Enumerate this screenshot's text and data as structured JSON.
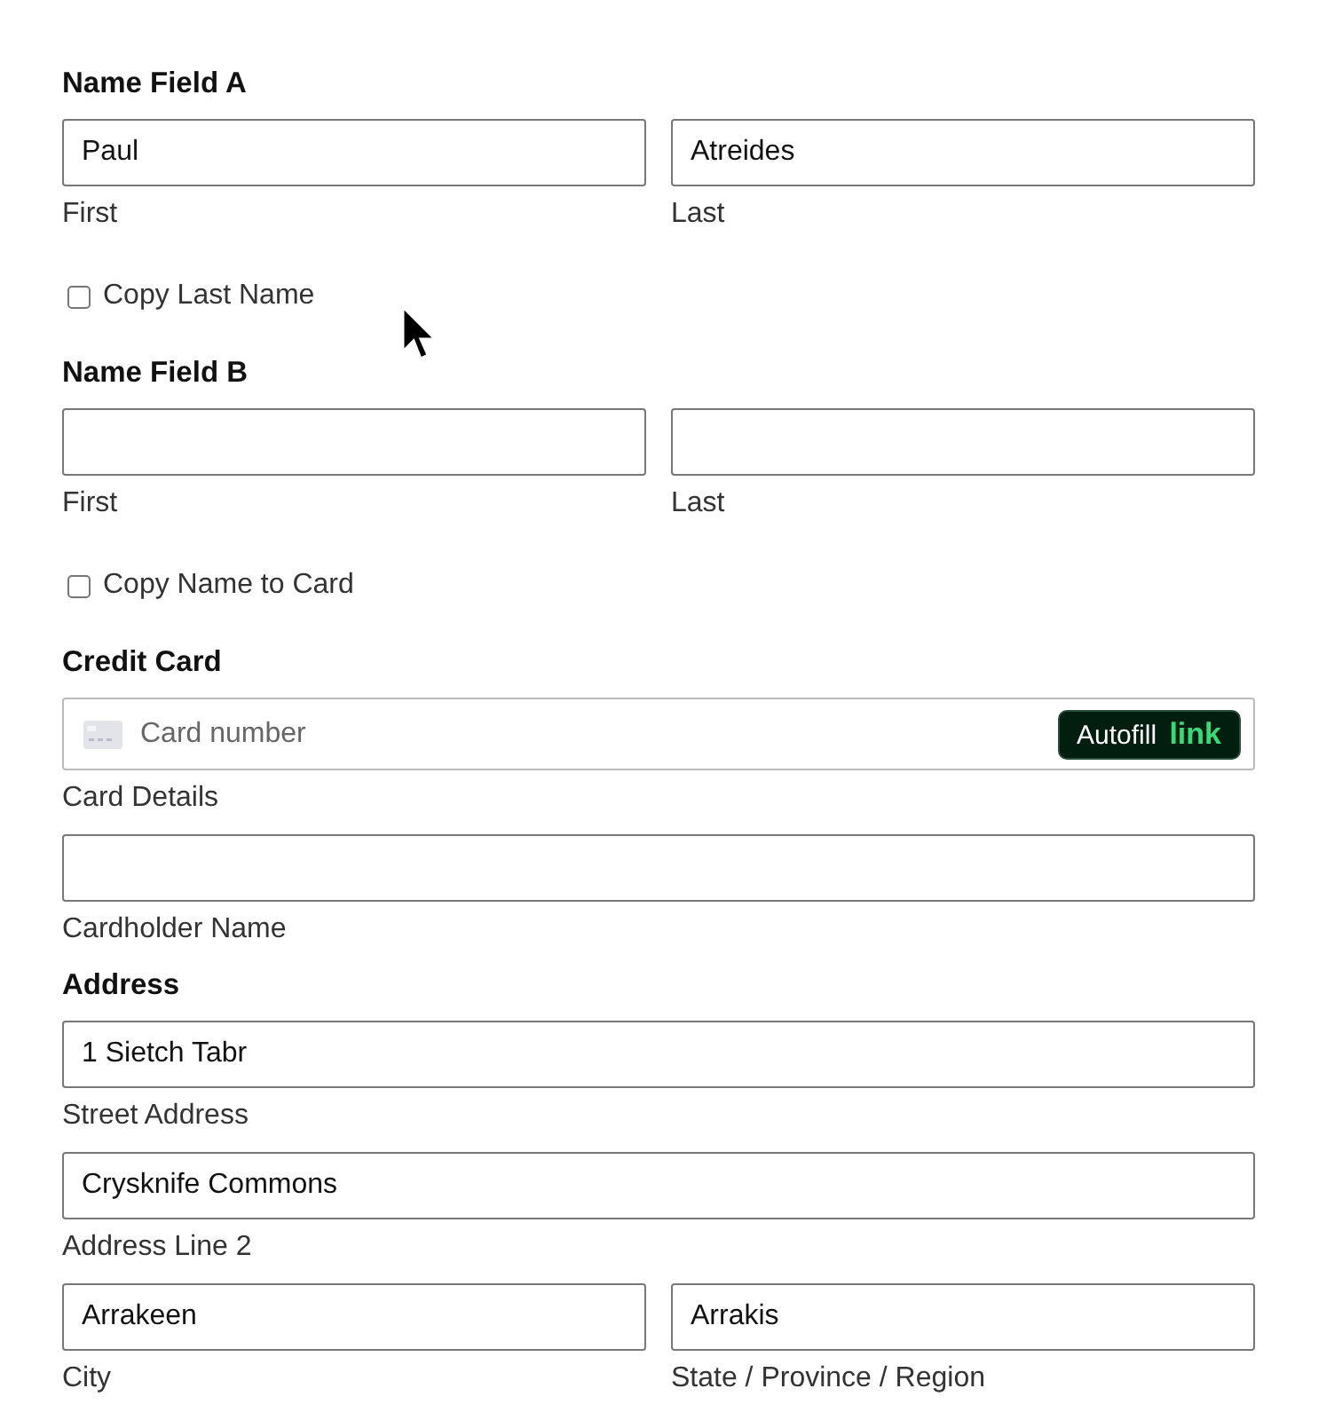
{
  "blocks": [
    {
      "kind": "heading",
      "text": "Name Field A"
    },
    {
      "kind": "fields",
      "fields": [
        {
          "value": "Paul",
          "label": "First"
        },
        {
          "value": "Atreides",
          "label": "Last"
        }
      ]
    },
    {
      "kind": "checkbox",
      "label": "Copy Last Name",
      "checked": false
    },
    {
      "kind": "heading",
      "text": "Name Field B"
    },
    {
      "kind": "fields",
      "fields": [
        {
          "label": "First"
        },
        {
          "label": "Last"
        }
      ]
    },
    {
      "kind": "checkbox",
      "label": "Copy Name to Card",
      "checked": false
    },
    {
      "kind": "heading",
      "text": "Credit Card"
    },
    {
      "kind": "card",
      "placeholder": "Card number",
      "button": "Autofill",
      "brand": "link",
      "label": "Card Details"
    },
    {
      "kind": "fields",
      "fields": [
        {
          "label": "Cardholder Name"
        }
      ]
    },
    {
      "kind": "heading",
      "text": "Address"
    },
    {
      "kind": "fields",
      "fields": [
        {
          "value": "1 Sietch Tabr",
          "label": "Street Address"
        }
      ]
    },
    {
      "kind": "fields",
      "fields": [
        {
          "value": "Crysknife Commons",
          "label": "Address Line 2"
        }
      ]
    },
    {
      "kind": "fields",
      "fields": [
        {
          "value": "Arrakeen",
          "label": "City"
        },
        {
          "value": "Arrakis",
          "label": "State / Province / Region"
        }
      ]
    }
  ]
}
